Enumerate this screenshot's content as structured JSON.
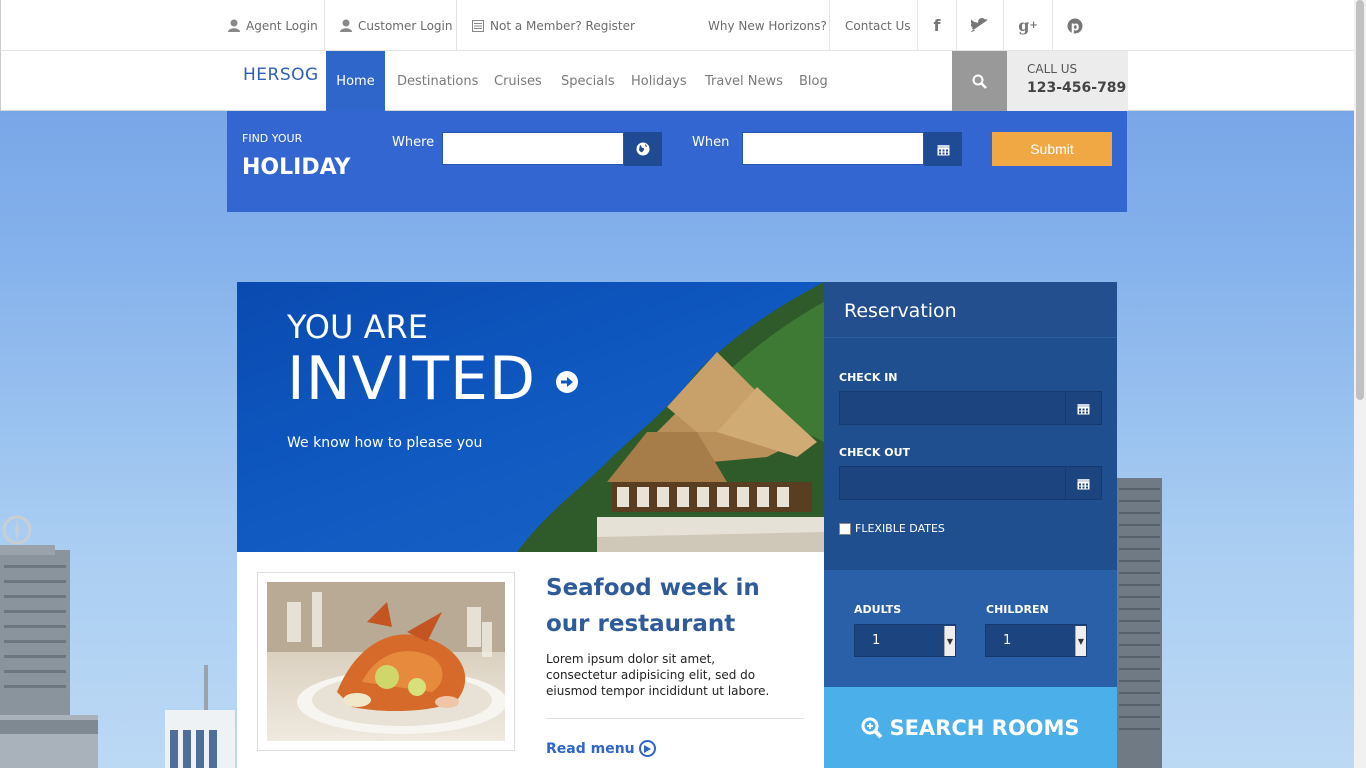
{
  "topbar": {
    "agent_login": "Agent Login",
    "customer_login": "Customer Login",
    "register": "Not a Member? Register",
    "why": "Why New Horizons?",
    "contact": "Contact Us",
    "social": [
      "f",
      "twitter-icon",
      "g+",
      "pinterest-icon"
    ]
  },
  "nav": {
    "logo": "HERSOG",
    "items": [
      "Home",
      "Destinations",
      "Cruises",
      "Specials",
      "Holidays",
      "Travel News",
      "Blog"
    ],
    "active": "Home",
    "call_label": "CALL US",
    "call_number": "123-456-789"
  },
  "holiday": {
    "small": "FIND YOUR",
    "big": "HOLIDAY",
    "where_label": "Where",
    "when_label": "When",
    "where_value": "",
    "when_value": "",
    "submit": "Submit"
  },
  "hero": {
    "line1": "YOU ARE",
    "line2": "INVITED",
    "subtitle": "We know how to please you"
  },
  "reservation": {
    "title": "Reservation",
    "check_in_label": "CHECK IN",
    "check_out_label": "CHECK OUT",
    "check_in_value": "",
    "check_out_value": "",
    "flexible_label": "FLEXIBLE DATES",
    "flexible_checked": false,
    "adults_label": "ADULTS",
    "children_label": "CHILDREN",
    "adults_value": "1",
    "children_value": "1",
    "search_label": "SEARCH ROOMS"
  },
  "article": {
    "title": "Seafood week in our restaurant",
    "body": "Lorem ipsum dolor sit amet, consectetur adipisicing elit, sed do eiusmod tempor incididunt ut labore.",
    "read_more": "Read menu"
  },
  "colors": {
    "brand_blue": "#3466d1",
    "nav_active": "#2f66c9",
    "submit_orange": "#f0a844",
    "reservation_dark": "#1f4f8e",
    "search_rooms": "#4bb0ea"
  }
}
